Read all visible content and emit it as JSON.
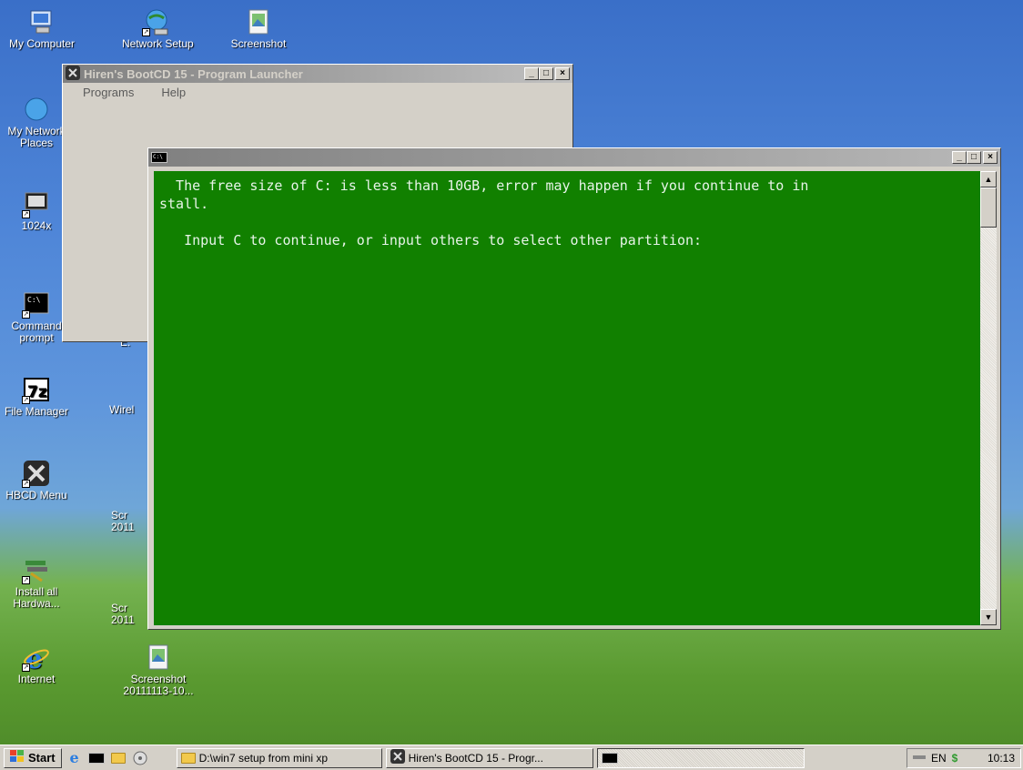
{
  "desktop": {
    "icons": [
      {
        "label": "My Computer",
        "icon": "my-computer-icon"
      },
      {
        "label": "Network Setup",
        "icon": "network-setup-icon"
      },
      {
        "label": "Screenshot",
        "icon": "screenshot-icon"
      },
      {
        "label": "My Network Places",
        "icon": "network-places-icon"
      },
      {
        "label": "1024x",
        "icon": "resolution-icon"
      },
      {
        "label": "Command prompt",
        "icon": "command-prompt-icon"
      },
      {
        "label": "File Manager",
        "icon": "7zip-icon"
      },
      {
        "label": "Wirel",
        "icon": "wireless-icon"
      },
      {
        "label": "HBCD Menu",
        "icon": "hbcd-menu-icon"
      },
      {
        "label": "Scr 2011",
        "icon": "screenshot-icon"
      },
      {
        "label": "Install all Hardwa...",
        "icon": "install-hardware-icon"
      },
      {
        "label": "Scr 2011",
        "icon": "screenshot-icon"
      },
      {
        "label": "Internet",
        "icon": "internet-explorer-icon"
      },
      {
        "label": "Screenshot 20111113-10...",
        "icon": "screenshot-icon"
      },
      {
        "label": "E:",
        "icon": "drive-icon"
      }
    ]
  },
  "launcher": {
    "title": "Hiren's BootCD 15 - Program Launcher",
    "menu": [
      "Programs",
      "Help"
    ],
    "min_label": "_",
    "max_label": "□",
    "close_label": "×"
  },
  "console": {
    "title_icon": "C:\\",
    "line1": "  The free size of C: is less than 10GB, error may happen if you continue to in",
    "line2": "stall.",
    "line3": "",
    "line4": "   Input C to continue, or input others to select other partition:",
    "bg_color": "#118000"
  },
  "taskbar": {
    "start_label": "Start",
    "buttons": [
      {
        "label": "D:\\win7 setup from mini xp",
        "icon": "folder-icon"
      },
      {
        "label": "Hiren's BootCD 15 - Progr...",
        "icon": "hbcd-icon"
      },
      {
        "label": "",
        "icon": "command-prompt-icon"
      }
    ],
    "tray": {
      "lang": "EN",
      "time": "10:13"
    }
  }
}
